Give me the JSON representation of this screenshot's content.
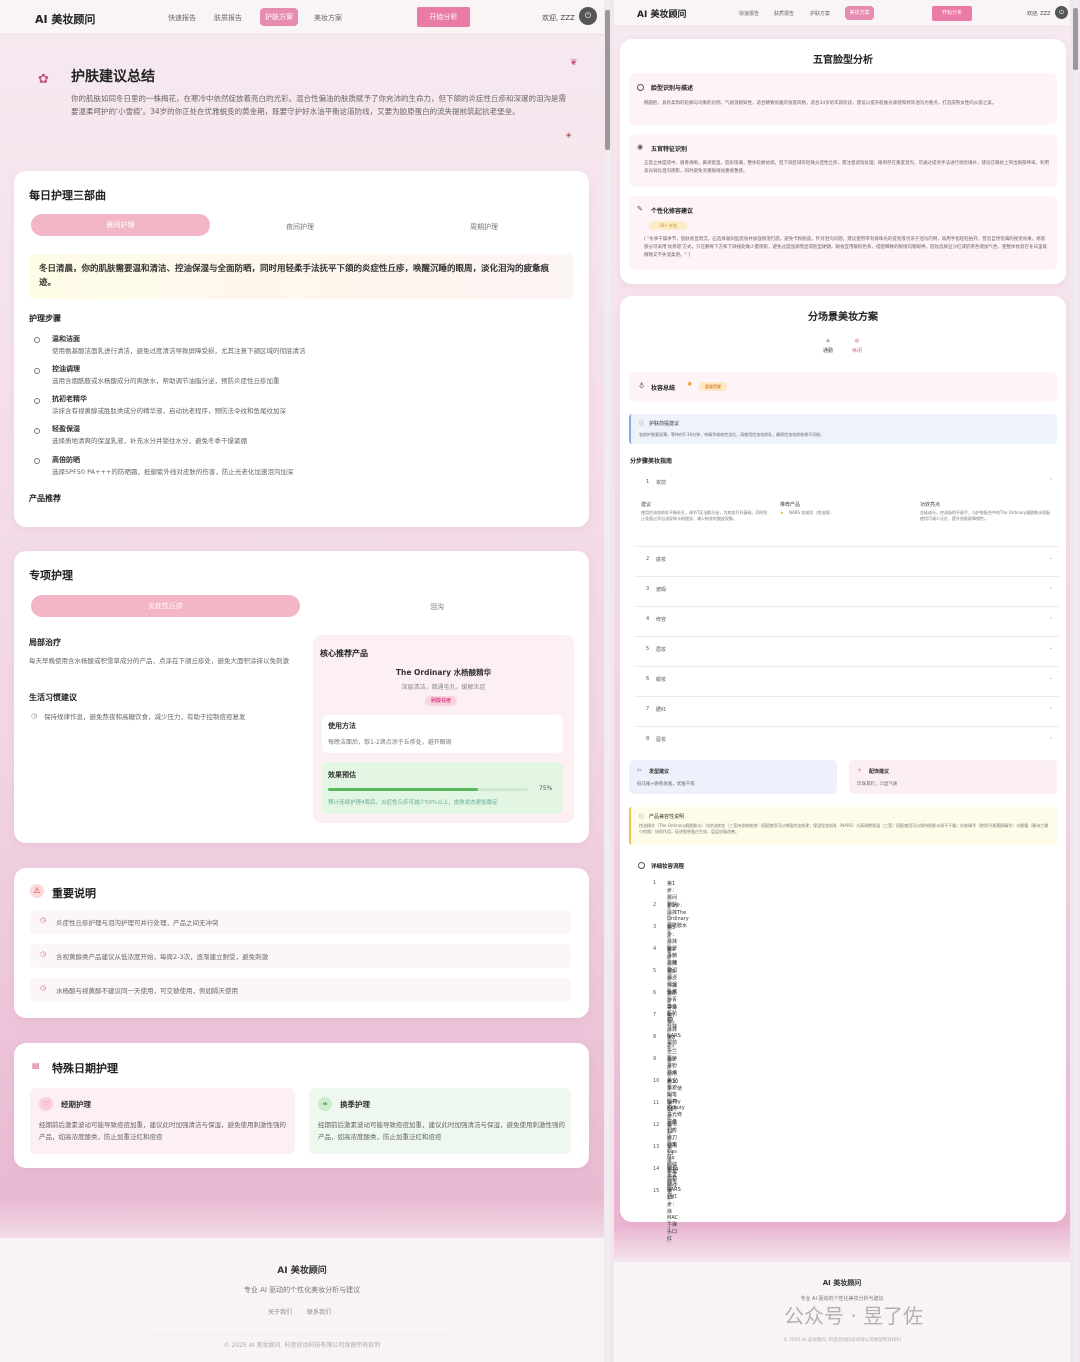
{
  "nav": {
    "logo": "AI 美妆顾问",
    "links": [
      "快速报告",
      "肤质报告",
      "护肤方案",
      "美妆方案"
    ],
    "start": "开始分析",
    "welcome": "欢迎, ZZZ"
  },
  "left": {
    "summary": {
      "title": "护肤建议总结",
      "text": "你的肌肤如同冬日里的一株梅花，在寒冷中依然绽放着亮白的光彩。混合性偏油的肤质赋予了你充沛的生命力，但下颌的炎症性丘疹和深邃的泪沟是需要温柔呵护的'小雪痕'。34岁的你正处在优雅蜕变的黄金期，既要守护好水油平衡这道防线，又要为胶原蛋白的流失提前筑起抗老堡垒。"
    },
    "daily": {
      "title": "每日护理三部曲",
      "tabs": [
        "晨间护理",
        "夜间护理",
        "周期护理"
      ],
      "highlight": "冬日清晨，你的肌肤需要温和清洁、控油保湿与全面防晒，同时用轻柔手法抚平下颌的炎症性丘疹，唤醒沉睡的眼周，淡化泪沟的疲惫痕迹。",
      "steps_title": "护理步骤",
      "steps": [
        {
          "t": "温和洁面",
          "d": "使用氨基酸洁面乳进行清洁，避免过度清洁导致屏障受损，尤其注意下颌区域的彻底清洁"
        },
        {
          "t": "控油调理",
          "d": "选用含烟酰胺或水杨酸成分的爽肤水，帮助调节油脂分泌，预防炎症性丘疹加重"
        },
        {
          "t": "抗初老精华",
          "d": "涂抹含有视黄醇或胜肽类成分的精华液，启动抗老程序，预防法令纹和鱼尾纹加深"
        },
        {
          "t": "轻盈保湿",
          "d": "选择质地清爽的保湿乳液，补充水分并锁住水分，避免冬季干燥紧绷"
        },
        {
          "t": "高倍防晒",
          "d": "选择SPF50 PA+++的防晒霜，抵御紫外线对皮肤的伤害，防止光老化加速泪沟加深"
        }
      ],
      "products_title": "产品推荐"
    },
    "special": {
      "title": "专项护理",
      "tabs": [
        "炎症性丘疹",
        "泪沟"
      ],
      "local_title": "局部治疗",
      "local_text": "每天早晚使用含水杨酸或积雪草成分的产品，点涂在下颌丘疹处，避免大面积涂抹以免刺激",
      "life_title": "生活习惯建议",
      "life_text": "保持规律作息，避免熬夜和高糖饮食，减少压力，有助于控制痘痘复发",
      "core_title": "核心推荐产品",
      "product_name": "The Ordinary 水杨酸精华",
      "product_desc": "深层清洁，疏通毛孔，缓解炎症",
      "product_tag": "刷酸祛痘",
      "usage_title": "使用方法",
      "usage_text": "每晚洁面后，取1-2滴点涂于丘疹处，避开眼周",
      "effect_title": "效果预估",
      "effect_pct": "75%",
      "effect_value": 75,
      "effect_text": "预计连续护理4周后，炎症性丘疹可减少50%以上，皮肤状态更加稳定"
    },
    "notes": {
      "title": "重要说明",
      "items": [
        "炎症性丘疹护理与泪沟护理可并行处理，产品之间无冲突",
        "含视黄醇类产品建议从低浓度开始，每周2-3次，逐渐建立耐受，避免刺激",
        "水杨酸与视黄醇不建议同一天使用，可交替使用，例如隔天使用"
      ]
    },
    "special_days": {
      "title": "特殊日期护理",
      "period_title": "经期护理",
      "period_text": "经期前后激素波动可能导致痘痘加重，建议此时加强清洁与保湿，避免使用刺激性强的产品，如高浓度酸类，防止加重泛红和痘痘",
      "season_title": "换季护理",
      "season_text": "经期前后激素波动可能导致痘痘加重，建议此时加强清洁与保湿，避免使用刺激性强的产品，如高浓度酸类，防止加重泛红和痘痘"
    },
    "footer": {
      "brand": "AI 美妆顾问",
      "slogan": "专业 AI 驱动的个性化美妆分析与建议",
      "links": [
        "关于我们",
        "联系我们"
      ],
      "copyright": "© 2025 AI 美妆顾问. 科思创动科技有限公司保留所有权利"
    }
  },
  "right": {
    "face": {
      "title": "五官脸型分析",
      "shape_title": "脸型识别与描述",
      "shape_text": "椭圆脸，具有柔和的轮廓与均衡的比例，气质温婉知性，适合精致优雅的妆容风格。适合34岁的年龄阶段，建议以提升肌肤光泽感和修饰泪沟为重点，打造成熟女性的从容之美。",
      "features_title": "五官特征识别",
      "features_text": "五官立体度适中，眉骨清晰，鼻梁挺直，唇形饱满，整体轮廓协调。但下颌区域有轻微炎症性丘疹，需注意遮瑕处理；眼周存在重度泪沟，可通过提亮手法进行视觉填补，建议在眼妆上突出眼部神采，利用高光弱化泪沟阴影，同时避免浓重眼线加重疲惫感。",
      "tips_title": "个性化修容建议",
      "tips_badge": "30+ 岁适",
      "tips_text": "[ \"冬季干燥季节，肌肤易显暗沉，应选择滋润型底妆并加强保湿打底，避免卡粉脱皮。针对泪沟问题，建议使用带有微珠光的提亮液点涂于泪沟内侧，再用手指轻轻拍开，营造自然饱满的视觉效果。修容部分可采用'砍修容'方式，只在颧骨下方和下颌线处做少量阴影，避免过度强调而显得脸型硬朗。眼妆宜用暖棕色系，搭配细致的眼线勾勒眼神，唇妆选择豆沙红或奶茶色增加气色，使整体妆容在冬日里既精致又不失温柔感。\" ]"
    },
    "scene": {
      "title": "分场景美妆方案",
      "tabs": [
        "通勤",
        "休闲"
      ],
      "summary_title": "妆容总结",
      "summary_tag": "重要提醒",
      "care_title": "护肤前提建议",
      "care_text": "妆前护肤要轻薄，等待约5-10分钟，待精华吸收完全后，再使用控油妆前乳，确保控油妆前效果不浮粉。",
      "guide_title": "分步骤美妆指南",
      "steps": [
        "妆前",
        "底妆",
        "遮瑕",
        "修容",
        "眉妆",
        "眼妆",
        "腮红",
        "唇妆"
      ],
      "step1": {
        "s_title": "建议",
        "s_text": "使用控油妆前乳平衡毛孔，调节T区油脂分泌，为底妆打好基础，同时防止妆面过早出油导致卡粉脱妆，减少粉妆的脱皮现象。",
        "p_title": "推荐产品",
        "p_text": "NARS 妆前乳（控油版）",
        "h_title": "功效亮点",
        "h_text": "含硅成分，控油吸附不留手，与护肤配合中的The Ordinary烟酰胺水搭配使用可减少泛红，提升肌肤屏障韧性。"
      },
      "hair_title": "发型建议",
      "hair_text": "低马尾+微卷发尾，优雅干练",
      "acc_title": "配饰建议",
      "acc_text": "珍珠耳钉，凸显气质",
      "compat_title": "产品兼容性说明",
      "compat_text": "控油精华（The Ordinary烟酰胺水）与控油底妆（三莹持妆粉底液）搭配使用可以增强控油效果；保湿型妆前乳（NARS）与高周期保湿（三莹）搭配使用可以保持肌肤水润不干燥；抗老精华（欧舒丹视黄醇精华）与眼霜（雅诗兰黛小棕瓶）协同作用，促进胶原蛋白生成，层层加强改善。",
      "detail_title": "详细妆容流程",
      "flow": [
        {
          "a": "第1步：晨间护肤",
          "b": "使用氨基酸洁面乳清洁面部"
        },
        {
          "a": "第2步：涂抹The Ordinary烟酰胺水",
          "b": "控油提亮肤色"
        },
        {
          "a": "第3步：涂抹欧舒丹精华精华",
          "b": "启动抗老程序"
        },
        {
          "a": "第4步：涂抹珂润润浸保湿乳液",
          "b": "补水保湿"
        },
        {
          "a": "第5步：涂抹安热沙青春金瓶防晒",
          "b": "全面防护紫外线"
        },
        {
          "a": "第6步：等待5-10分钟",
          "b": "待产品充分吸收"
        },
        {
          "a": "第7步：涂抹NARS妆前乳",
          "b": "平衡毛孔，控油打底"
        },
        {
          "a": "第8步：上兰蔻持妆粉底液",
          "b": "打造轻薄持妆底妆"
        },
        {
          "a": "第9步：使用美宝莲遮瑕笔提亮眼周",
          "b": "淡化泪沟"
        },
        {
          "a": "第10步：使用Fenty Beauty高光修容盘",
          "b": "提升面部立体感"
        },
        {
          "a": "第11步：画植村秀砍刀眉笔",
          "b": "勾勒自然眉形"
        },
        {
          "a": "第12步：使用Kiss Me眼线液笔勾勒眼线",
          "b": "增强眼神深邃感"
        },
        {
          "a": "第13步：刷资生堂睫毛膏",
          "b": "拉长睫毛卷翘"
        },
        {
          "a": "第14步：扫NARS腮红",
          "b": "提升气色"
        },
        {
          "a": "第15步：涂MAC子弹头口红",
          "b": "点缀提升整体气色"
        }
      ]
    },
    "footer": {
      "brand": "AI 美妆顾问",
      "slogan": "专业 AI 驱动的个性化美妆分析与建议",
      "copyright": "© 2025 AI 美妆顾问. 科思创动科技有限公司保留所有权利"
    },
    "watermark": "公众号 · 昱了佐"
  }
}
